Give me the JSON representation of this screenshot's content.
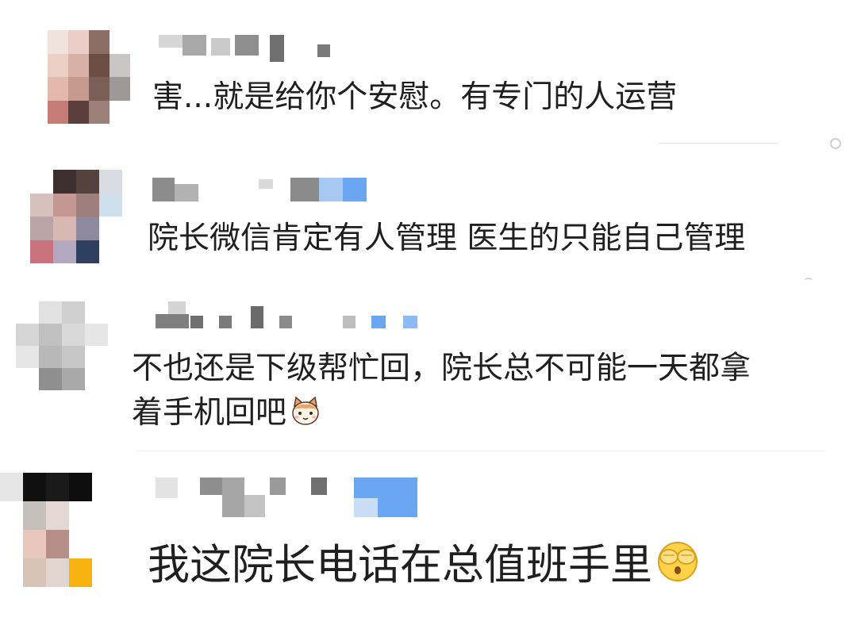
{
  "comments": [
    {
      "text": "害...就是给你个安慰。有专门的人运营"
    },
    {
      "text": "院长微信肯定有人管理 医生的只能自己管理"
    },
    {
      "text": "不也还是下级帮忙回，院长总不可能一天都拿",
      "text_line2": "着手机回吧",
      "emoji": "cat-face-icon"
    },
    {
      "text": "我这院长电话在总值班手里",
      "emoji": "covering-eyes-face-icon"
    }
  ],
  "colors": {
    "text": "#1f1f1f",
    "link_blue": "#6aa6f2",
    "divider": "#ededed"
  }
}
